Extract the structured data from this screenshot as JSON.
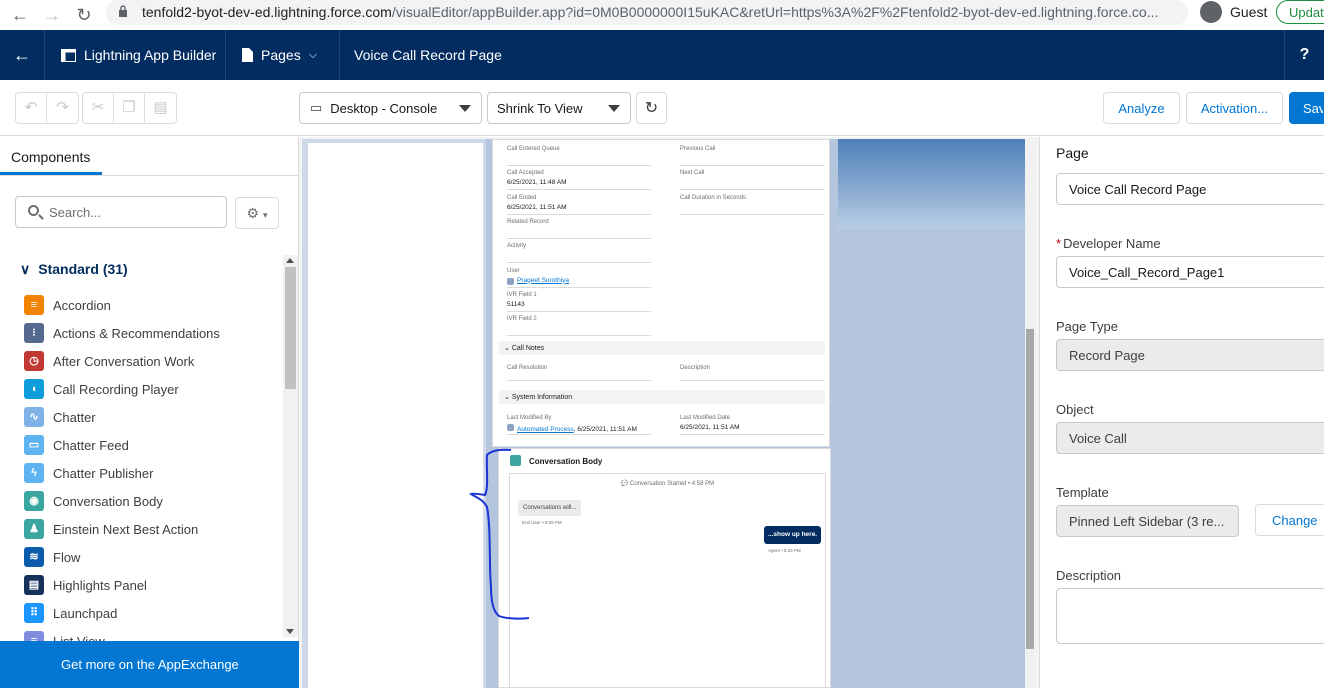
{
  "browser": {
    "url_host": "tenfold2-byot-dev-ed.lightning.force.com",
    "url_path": "/visualEditor/appBuilder.app?id=0M0B0000000I15uKAC&retUrl=https%3A%2F%2Ftenfold2-byot-dev-ed.lightning.force.co...",
    "profile_label": "Guest",
    "update_label": "Update"
  },
  "header": {
    "app_name": "Lightning App Builder",
    "pages_label": "Pages",
    "page_title": "Voice Call Record Page",
    "help": "?"
  },
  "toolbar": {
    "device_select": "Desktop - Console",
    "zoom_select": "Shrink To View",
    "analyze_label": "Analyze",
    "activation_label": "Activation...",
    "save_label": "Save"
  },
  "left_panel": {
    "tab_label": "Components",
    "search_placeholder": "Search...",
    "section_label": "Standard (31)",
    "components": [
      {
        "label": "Accordion",
        "color": "#f38303",
        "glyph": "≡"
      },
      {
        "label": "Actions & Recommendations",
        "color": "#54698d",
        "glyph": "⁝"
      },
      {
        "label": "After Conversation Work",
        "color": "#c23934",
        "glyph": "◷"
      },
      {
        "label": "Call Recording Player",
        "color": "#0d9dda",
        "glyph": "◖"
      },
      {
        "label": "Chatter",
        "color": "#7fb3e8",
        "glyph": "∿"
      },
      {
        "label": "Chatter Feed",
        "color": "#5eb4f0",
        "glyph": "▭"
      },
      {
        "label": "Chatter Publisher",
        "color": "#5eb4f0",
        "glyph": "ϟ"
      },
      {
        "label": "Conversation Body",
        "color": "#3ba59f",
        "glyph": "◉"
      },
      {
        "label": "Einstein Next Best Action",
        "color": "#3ba59f",
        "glyph": "♟"
      },
      {
        "label": "Flow",
        "color": "#0b5cab",
        "glyph": "≋"
      },
      {
        "label": "Highlights Panel",
        "color": "#16325c",
        "glyph": "▤"
      },
      {
        "label": "Launchpad",
        "color": "#1b96ff",
        "glyph": "⠿"
      },
      {
        "label": "List View",
        "color": "#7f8de1",
        "glyph": "≡"
      }
    ],
    "appexchange_label": "Get more on the AppExchange"
  },
  "canvas": {
    "fields": [
      {
        "label": "Call Entered Queue",
        "value": ""
      },
      {
        "label": "Previous Call",
        "value": ""
      },
      {
        "label": "Call Accepted",
        "value": "6/25/2021, 11:48 AM"
      },
      {
        "label": "Next Call",
        "value": ""
      },
      {
        "label": "Call Ended",
        "value": "6/25/2021, 11:51 AM"
      },
      {
        "label": "Call Duration in Seconds",
        "value": ""
      },
      {
        "label": "Related Record",
        "value": ""
      },
      {
        "label": "Activity",
        "value": ""
      },
      {
        "label": "User",
        "value": "Prageet Surothiya"
      },
      {
        "label": "IVR Field 1",
        "value": "51143"
      },
      {
        "label": "IVR Field 2",
        "value": ""
      }
    ],
    "call_notes_header": "Call Notes",
    "call_resolution_label": "Call Resolution",
    "description_label": "Description",
    "system_info_header": "System Information",
    "last_modified_by_label": "Last Modified By",
    "last_modified_by_user": "Automated Process",
    "last_modified_by_date": ", 6/25/2021, 11:51 AM",
    "last_modified_date_label": "Last Modified Date",
    "last_modified_date_value": "6/25/2021, 11:51 AM",
    "conversation_title": "Conversation Body",
    "conversation_started": "Conversation Started • 4:58 PM",
    "bubble_in": "Conversations will...",
    "bubble_in_meta": "End User • 5:09 PM",
    "bubble_out": "...show up here.",
    "bubble_out_meta": "Agent • 5:23 PM"
  },
  "right_panel": {
    "header": "Page",
    "label_value": "Voice Call Record Page",
    "developer_name_label": "Developer Name",
    "developer_name_value": "Voice_Call_Record_Page1",
    "page_type_label": "Page Type",
    "page_type_value": "Record Page",
    "object_label": "Object",
    "object_value": "Voice Call",
    "template_label": "Template",
    "template_value": "Pinned Left Sidebar (3 re...",
    "change_label": "Change",
    "description_label": "Description",
    "required_mark": "*"
  }
}
